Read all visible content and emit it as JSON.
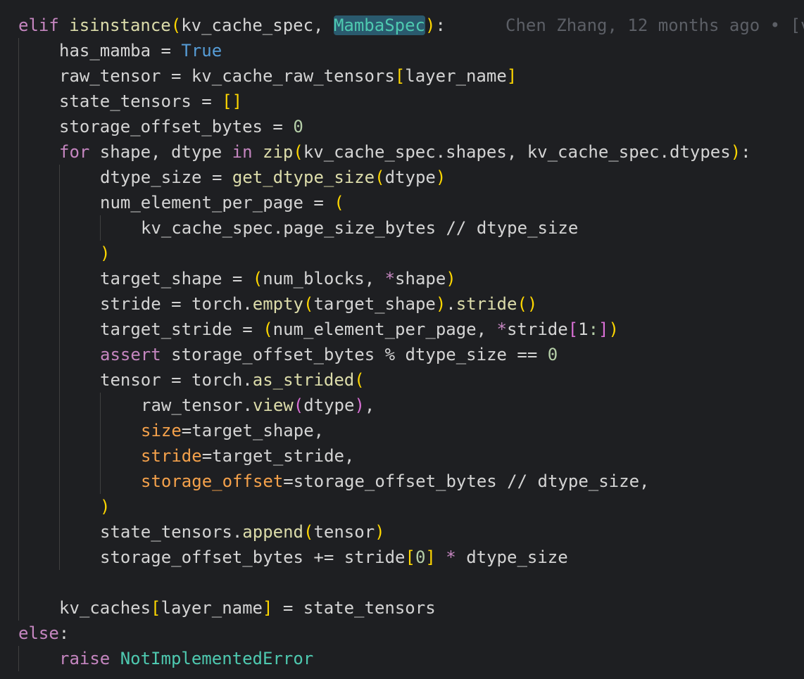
{
  "blame": "Chen Zhang, 12 months ago • [v",
  "lines": [
    {
      "indent": 0,
      "guides": 0,
      "tokens": [
        [
          "elif",
          "kw-ctrl"
        ],
        [
          " ",
          ""
        ],
        [
          "isinstance",
          "fn"
        ],
        [
          "(",
          "b1"
        ],
        [
          "kv_cache_spec, ",
          ""
        ],
        [
          "MambaSpec",
          "cls hl"
        ],
        [
          ")",
          "b1"
        ],
        [
          ":",
          ""
        ]
      ]
    },
    {
      "indent": 1,
      "guides": 1,
      "tokens": [
        [
          "has_mamba = ",
          ""
        ],
        [
          "True",
          "kw-bool"
        ]
      ]
    },
    {
      "indent": 1,
      "guides": 1,
      "tokens": [
        [
          "raw_tensor = kv_cache_raw_tensors",
          ""
        ],
        [
          "[",
          "b1"
        ],
        [
          "layer_name",
          ""
        ],
        [
          "]",
          "b1"
        ]
      ]
    },
    {
      "indent": 1,
      "guides": 1,
      "tokens": [
        [
          "state_tensors = ",
          ""
        ],
        [
          "[]",
          "b1"
        ]
      ]
    },
    {
      "indent": 1,
      "guides": 1,
      "tokens": [
        [
          "storage_offset_bytes = ",
          ""
        ],
        [
          "0",
          "num"
        ]
      ]
    },
    {
      "indent": 1,
      "guides": 1,
      "tokens": [
        [
          "for",
          "kw-ctrl"
        ],
        [
          " shape, dtype ",
          ""
        ],
        [
          "in",
          "kw-ctrl"
        ],
        [
          " ",
          ""
        ],
        [
          "zip",
          "fn"
        ],
        [
          "(",
          "b1"
        ],
        [
          "kv_cache_spec.shapes, kv_cache_spec.dtypes",
          ""
        ],
        [
          ")",
          "b1"
        ],
        [
          ":",
          ""
        ]
      ]
    },
    {
      "indent": 2,
      "guides": 2,
      "tokens": [
        [
          "dtype_size = ",
          ""
        ],
        [
          "get_dtype_size",
          "fn"
        ],
        [
          "(",
          "b1"
        ],
        [
          "dtype",
          ""
        ],
        [
          ")",
          "b1"
        ]
      ]
    },
    {
      "indent": 2,
      "guides": 2,
      "tokens": [
        [
          "num_element_per_page = ",
          ""
        ],
        [
          "(",
          "b1"
        ]
      ]
    },
    {
      "indent": 3,
      "guides": 3,
      "tokens": [
        [
          "kv_cache_spec.page_size_bytes // dtype_size",
          ""
        ]
      ]
    },
    {
      "indent": 2,
      "guides": 2,
      "tokens": [
        [
          ")",
          "b1"
        ]
      ]
    },
    {
      "indent": 2,
      "guides": 2,
      "tokens": [
        [
          "target_shape = ",
          ""
        ],
        [
          "(",
          "b1"
        ],
        [
          "num_blocks, ",
          ""
        ],
        [
          "*",
          "kw-ctrl"
        ],
        [
          "shape",
          ""
        ],
        [
          ")",
          "b1"
        ]
      ]
    },
    {
      "indent": 2,
      "guides": 2,
      "tokens": [
        [
          "stride = torch.",
          ""
        ],
        [
          "empty",
          "fn"
        ],
        [
          "(",
          "b1"
        ],
        [
          "target_shape",
          ""
        ],
        [
          ")",
          "b1"
        ],
        [
          ".",
          ""
        ],
        [
          "stride",
          "fn"
        ],
        [
          "()",
          "b1"
        ]
      ]
    },
    {
      "indent": 2,
      "guides": 2,
      "tokens": [
        [
          "target_stride = ",
          ""
        ],
        [
          "(",
          "b1"
        ],
        [
          "num_element_per_page, ",
          ""
        ],
        [
          "*",
          "kw-ctrl"
        ],
        [
          "stride",
          ""
        ],
        [
          "[",
          "b2"
        ],
        [
          "1",
          ""
        ],
        [
          ":",
          "num"
        ],
        [
          "]",
          "b2"
        ],
        [
          ")",
          "b1"
        ]
      ]
    },
    {
      "indent": 2,
      "guides": 2,
      "tokens": [
        [
          "assert",
          "kw-ctrl"
        ],
        [
          " storage_offset_bytes % dtype_size == ",
          ""
        ],
        [
          "0",
          "num"
        ]
      ]
    },
    {
      "indent": 2,
      "guides": 2,
      "tokens": [
        [
          "tensor = torch.",
          ""
        ],
        [
          "as_strided",
          "fn"
        ],
        [
          "(",
          "b1"
        ]
      ]
    },
    {
      "indent": 3,
      "guides": 3,
      "tokens": [
        [
          "raw_tensor.",
          ""
        ],
        [
          "view",
          "fn"
        ],
        [
          "(",
          "b2"
        ],
        [
          "dtype",
          ""
        ],
        [
          ")",
          "b2"
        ],
        [
          ",",
          ""
        ]
      ]
    },
    {
      "indent": 3,
      "guides": 3,
      "tokens": [
        [
          "size",
          "param"
        ],
        [
          "=target_shape,",
          ""
        ]
      ]
    },
    {
      "indent": 3,
      "guides": 3,
      "tokens": [
        [
          "stride",
          "param"
        ],
        [
          "=target_stride,",
          ""
        ]
      ]
    },
    {
      "indent": 3,
      "guides": 3,
      "tokens": [
        [
          "storage_offset",
          "param"
        ],
        [
          "=storage_offset_bytes // dtype_size,",
          ""
        ]
      ]
    },
    {
      "indent": 2,
      "guides": 2,
      "tokens": [
        [
          ")",
          "b1"
        ]
      ]
    },
    {
      "indent": 2,
      "guides": 2,
      "tokens": [
        [
          "state_tensors.",
          ""
        ],
        [
          "append",
          "fn"
        ],
        [
          "(",
          "b1"
        ],
        [
          "tensor",
          ""
        ],
        [
          ")",
          "b1"
        ]
      ]
    },
    {
      "indent": 2,
      "guides": 2,
      "tokens": [
        [
          "storage_offset_bytes += stride",
          ""
        ],
        [
          "[",
          "b1"
        ],
        [
          "0",
          "num"
        ],
        [
          "]",
          "b1"
        ],
        [
          " ",
          ""
        ],
        [
          "*",
          "kw-ctrl"
        ],
        [
          " dtype_size",
          ""
        ]
      ]
    },
    {
      "indent": 0,
      "guides": 1,
      "tokens": []
    },
    {
      "indent": 1,
      "guides": 1,
      "tokens": [
        [
          "kv_caches",
          ""
        ],
        [
          "[",
          "b1"
        ],
        [
          "layer_name",
          ""
        ],
        [
          "]",
          "b1"
        ],
        [
          " = state_tensors",
          ""
        ]
      ]
    },
    {
      "indent": 0,
      "guides": 0,
      "tokens": [
        [
          "else",
          "kw-ctrl"
        ],
        [
          ":",
          ""
        ]
      ]
    },
    {
      "indent": 1,
      "guides": 1,
      "tokens": [
        [
          "raise",
          "kw-ctrl"
        ],
        [
          " ",
          ""
        ],
        [
          "NotImplementedError",
          "cls"
        ]
      ]
    }
  ]
}
